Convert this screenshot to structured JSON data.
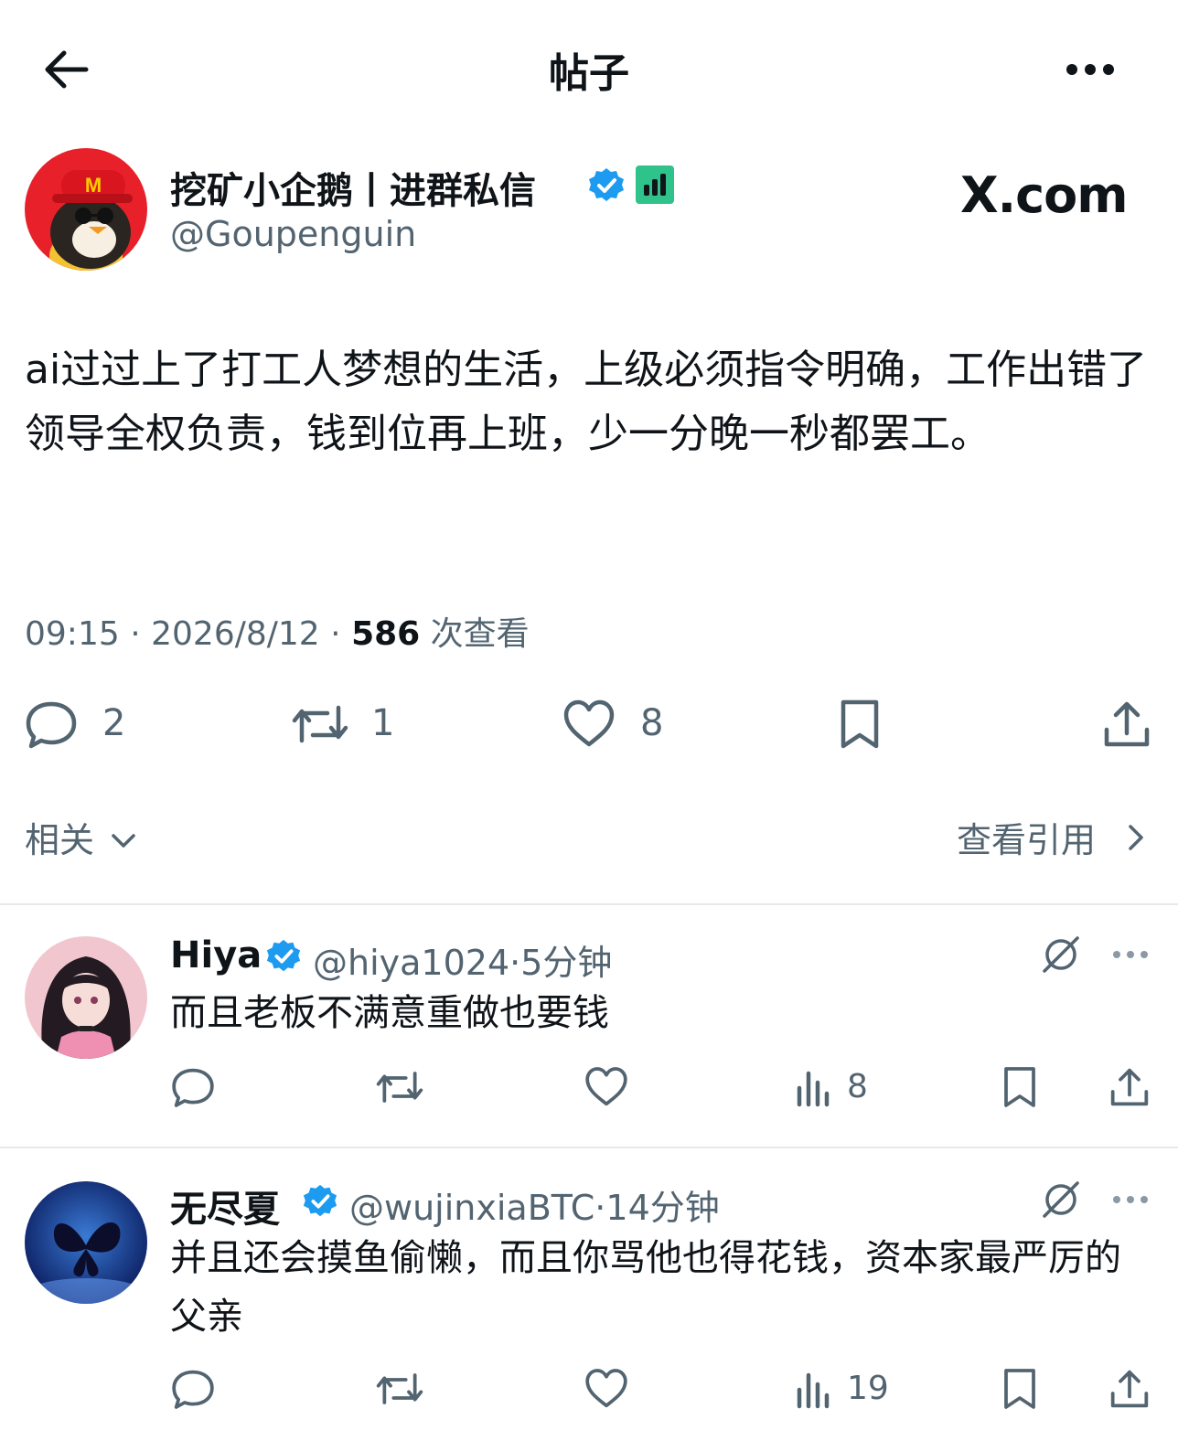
{
  "header": {
    "title": "帖子",
    "back_icon": "arrow-left-icon",
    "more_icon": "more-horizontal-icon"
  },
  "post": {
    "author_name": "挖矿小企鹅丨进群私信",
    "author_handle": "@Goupenguin",
    "watermark": "X.com",
    "text": "ai过过上了打工人梦想的生活，上级必须指令明确，工作出错了领导全权负责，钱到位再上班，少一分晚一秒都罢工。",
    "time": "09:15",
    "date": "2026/8/12",
    "views": "586",
    "views_label": "次查看",
    "sep": "·",
    "replies": "2",
    "reposts": "1",
    "likes": "8"
  },
  "related": {
    "label": "相关",
    "view_quotes": "查看引用"
  },
  "replies": [
    {
      "name": "Hiya",
      "handle": "@hiya1024",
      "time": "5分钟",
      "text": "而且老板不满意重做也要钱",
      "views": "8"
    },
    {
      "name": "无尽夏",
      "handle": "@wujinxiaBTC",
      "time": "14分钟",
      "text": "并且还会摸鱼偷懒，而且你骂他也得花钱，资本家最严厉的父亲",
      "views": "19"
    }
  ],
  "colors": {
    "verified": "#1d9bf0",
    "secondary": "#536471",
    "text": "#0f1419",
    "badge": "#2fc28b",
    "divider": "#e6e9eb"
  }
}
